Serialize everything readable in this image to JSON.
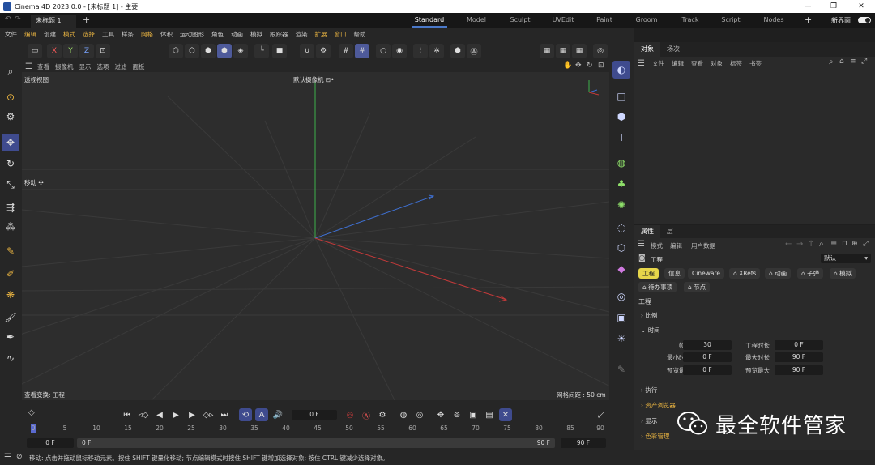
{
  "window": {
    "title": "Cinema 4D 2023.0.0 - [未标题 1] - 主要",
    "minimize": "—",
    "maximize": "❐",
    "close": "✕"
  },
  "doc_tab": {
    "label": "未标题 1",
    "close": "×",
    "add": "+"
  },
  "layouts": [
    {
      "label": "Standard",
      "active": true
    },
    {
      "label": "Model"
    },
    {
      "label": "Sculpt"
    },
    {
      "label": "UVEdit"
    },
    {
      "label": "Paint"
    },
    {
      "label": "Groom"
    },
    {
      "label": "Track"
    },
    {
      "label": "Script"
    },
    {
      "label": "Nodes"
    }
  ],
  "layout_add": "+",
  "new_ui": {
    "label": "新界面",
    "on": true
  },
  "menu": [
    {
      "label": "文件"
    },
    {
      "label": "编辑",
      "highlight": true
    },
    {
      "label": "创建"
    },
    {
      "label": "模式",
      "highlight": true
    },
    {
      "label": "选择",
      "highlight": true
    },
    {
      "label": "工具"
    },
    {
      "label": "样条"
    },
    {
      "label": "网格",
      "highlight": true
    },
    {
      "label": "体积"
    },
    {
      "label": "运动图形"
    },
    {
      "label": "角色"
    },
    {
      "label": "动画"
    },
    {
      "label": "模拟"
    },
    {
      "label": "跟踪器"
    },
    {
      "label": "渲染"
    },
    {
      "label": "扩展",
      "highlight": true
    },
    {
      "label": "窗口",
      "highlight": true
    },
    {
      "label": "帮助"
    }
  ],
  "axis_buttons": {
    "x": "X",
    "y": "Y",
    "z": "Z"
  },
  "viewport_menu": [
    "查看",
    "摄像机",
    "显示",
    "选项",
    "过滤",
    "面板"
  ],
  "viewport": {
    "view_name": "透视视图",
    "camera": "默认摄像机 ⊡•",
    "tool_hint": "移动 ✣",
    "bottom_left": "查看变换: 工程",
    "grid_spacing": "网格间距 : 50 cm"
  },
  "object_panel": {
    "tabs": [
      {
        "label": "对象",
        "active": true
      },
      {
        "label": "场次"
      }
    ],
    "menu": [
      "文件",
      "编辑",
      "查看",
      "对象",
      "标签",
      "书签"
    ]
  },
  "attr_panel": {
    "tabs": [
      {
        "label": "属性",
        "active": true
      },
      {
        "label": "层"
      }
    ],
    "menu": [
      "模式",
      "编辑",
      "用户数据"
    ],
    "object_label": "工程",
    "preset": "默认",
    "tabs_row1": [
      {
        "label": "工程",
        "active": true
      },
      {
        "label": "信息"
      },
      {
        "label": "Cineware"
      },
      {
        "label": "⌂ XRefs"
      },
      {
        "label": "⌂ 动画"
      },
      {
        "label": "⌂ 子弹"
      },
      {
        "label": "⌂ 模拟"
      }
    ],
    "tabs_row2": [
      {
        "label": "⌂ 待办事项"
      },
      {
        "label": "⌂ 节点"
      }
    ],
    "section_title": "工程",
    "sections": {
      "scale": "比例",
      "time": "时间",
      "exec": "执行",
      "asset": "资产浏览器",
      "display": "显示",
      "color": "色彩管理"
    },
    "fields": {
      "fps_label": "帧率",
      "fps": "30",
      "duration_label": "工程时长",
      "duration": "0 F",
      "min_label": "最小时长",
      "min": "0 F",
      "max_label": "最大时长",
      "max": "90 F",
      "pmin_label": "预览最小",
      "pmin": "0 F",
      "pmax_label": "预览最大",
      "pmax": "90 F"
    }
  },
  "timeline": {
    "current_frame": "0 F",
    "ticks": [
      "0",
      "5",
      "10",
      "15",
      "20",
      "25",
      "30",
      "35",
      "40",
      "45",
      "50",
      "55",
      "60",
      "65",
      "70",
      "75",
      "80",
      "85",
      "90"
    ],
    "start": "0 F",
    "range_start": "0 F",
    "range_end": "90 F",
    "end": "90 F"
  },
  "status": "移动: 点击并拖动鼠标移动元素。按住 SHIFT 键量化移动; 节点编辑模式时按住 SHIFT 键增加选择对象; 按住 CTRL 键减少选择对象。",
  "watermark": "最全软件管家"
}
